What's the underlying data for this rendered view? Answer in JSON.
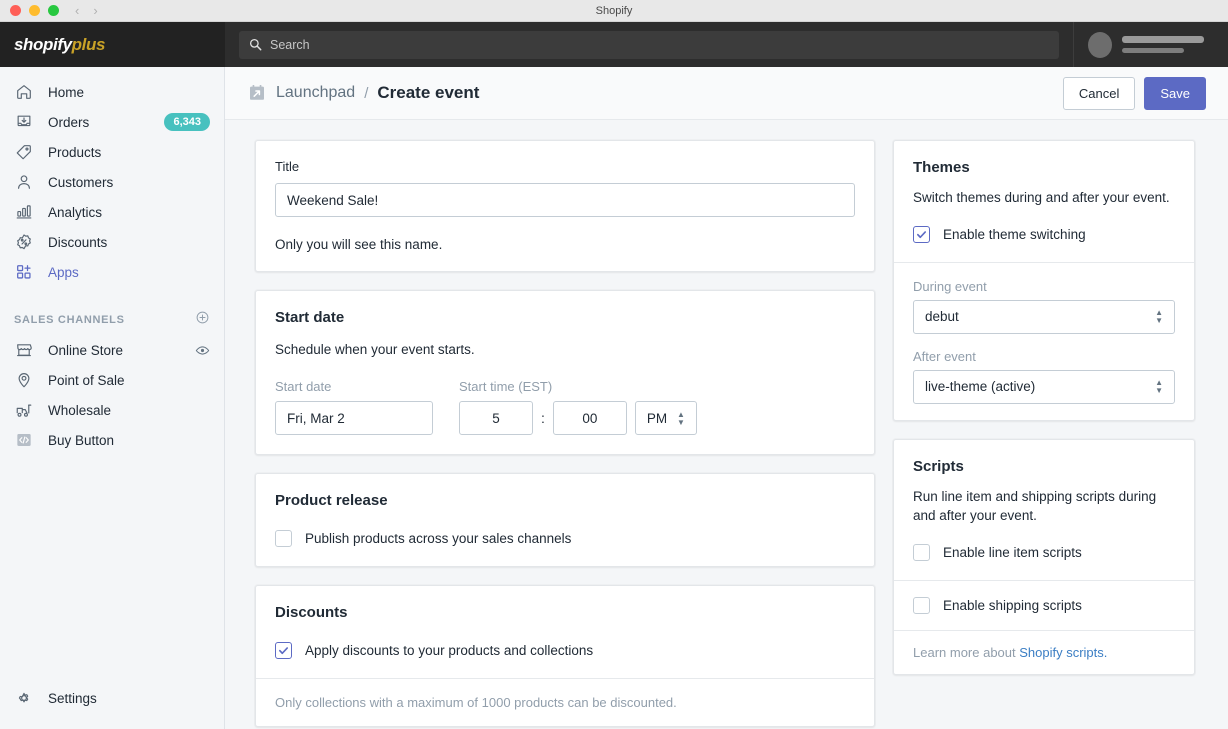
{
  "window": {
    "title": "Shopify"
  },
  "topbar": {
    "logo_white": "shopify",
    "logo_gold": "plus",
    "search_placeholder": "Search"
  },
  "sidebar": {
    "items": [
      {
        "label": "Home",
        "icon": "home-icon",
        "badge": null,
        "active": false
      },
      {
        "label": "Orders",
        "icon": "orders-icon",
        "badge": "6,343",
        "active": false
      },
      {
        "label": "Products",
        "icon": "products-tag-icon",
        "badge": null,
        "active": false
      },
      {
        "label": "Customers",
        "icon": "customers-person-icon",
        "badge": null,
        "active": false
      },
      {
        "label": "Analytics",
        "icon": "analytics-bar-icon",
        "badge": null,
        "active": false
      },
      {
        "label": "Discounts",
        "icon": "discounts-percent-icon",
        "badge": null,
        "active": false
      },
      {
        "label": "Apps",
        "icon": "apps-grid-plus-icon",
        "badge": null,
        "active": true
      }
    ],
    "section_title": "SALES CHANNELS",
    "channels": [
      {
        "label": "Online Store",
        "icon": "online-store-icon",
        "trailing_icon": "eye-icon"
      },
      {
        "label": "Point of Sale",
        "icon": "point-of-sale-pin-icon",
        "trailing_icon": null
      },
      {
        "label": "Wholesale",
        "icon": "wholesale-forklift-icon",
        "trailing_icon": null
      },
      {
        "label": "Buy Button",
        "icon": "buy-button-code-icon",
        "trailing_icon": null
      }
    ],
    "settings_label": "Settings",
    "badge_color": "#47c1bf",
    "active_color": "#5c6ac4"
  },
  "header": {
    "breadcrumb_parent": "Launchpad",
    "breadcrumb_separator": "/",
    "breadcrumb_current": "Create event",
    "cancel_label": "Cancel",
    "save_label": "Save",
    "primary_color": "#5c6ac4"
  },
  "main": {
    "title_card": {
      "label": "Title",
      "value": "Weekend Sale!",
      "placeholder": "Title",
      "help": "Only you will see this name."
    },
    "start_date_card": {
      "title": "Start date",
      "description": "Schedule when your event starts.",
      "date_label": "Start date",
      "date_value": "Fri, Mar 2",
      "time_label": "Start time (EST)",
      "hour_value": "5",
      "colon": ":",
      "minute_value": "00",
      "ampm_value": "PM"
    },
    "product_release_card": {
      "title": "Product release",
      "checkbox_label": "Publish products across your sales channels",
      "checked": false
    },
    "discounts_card": {
      "title": "Discounts",
      "checkbox_label": "Apply discounts to your products and collections",
      "checked": true,
      "footnote": "Only collections with a maximum of 1000 products can be discounted."
    }
  },
  "aside": {
    "themes_card": {
      "title": "Themes",
      "description": "Switch themes during and after your event.",
      "checkbox_label": "Enable theme switching",
      "checked": true,
      "during_label": "During event",
      "during_value": "debut",
      "after_label": "After event",
      "after_value": "live-theme (active)"
    },
    "scripts_card": {
      "title": "Scripts",
      "description": "Run line item and shipping scripts during and after your event.",
      "line_item_label": "Enable line item scripts",
      "line_item_checked": false,
      "shipping_label": "Enable shipping scripts",
      "shipping_checked": false,
      "footer_prefix": "Learn more about ",
      "footer_link": "Shopify scripts.",
      "link_color": "#3b7ec4"
    }
  }
}
